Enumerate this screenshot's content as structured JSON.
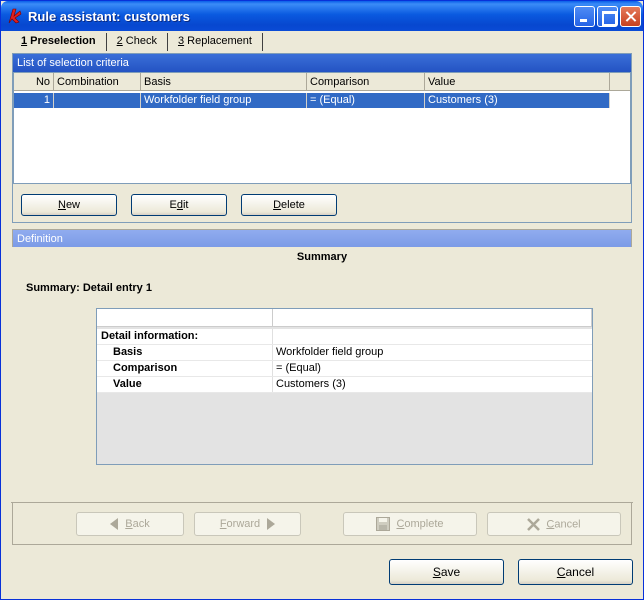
{
  "window": {
    "title": "Rule assistant: customers"
  },
  "tabs": [
    {
      "num": "1",
      "label": " Preselection"
    },
    {
      "num": "2",
      "label": " Check"
    },
    {
      "num": "3",
      "label": " Replacement"
    }
  ],
  "criteria": {
    "header": "List of selection criteria",
    "columns": [
      "No",
      "Combination",
      "Basis",
      "Comparison",
      "Value"
    ],
    "rows": [
      {
        "no": "1",
        "combination": "",
        "basis": "Workfolder field group",
        "comparison": "=  (Equal)",
        "value": "Customers (3)"
      }
    ]
  },
  "list_buttons": {
    "new": {
      "mnemonic": "N",
      "rest": "ew"
    },
    "edit": {
      "pre": "E",
      "mnemonic": "d",
      "rest": "it"
    },
    "delete": {
      "mnemonic": "D",
      "rest": "elete"
    }
  },
  "definition": {
    "header": "Definition",
    "summary_title": "Summary",
    "summary_sub": "Summary: Detail entry 1",
    "detail_title": "Detail information:",
    "details": [
      {
        "key": "Basis",
        "value": "Workfolder field group"
      },
      {
        "key": "Comparison",
        "value": "=  (Equal)"
      },
      {
        "key": "Value",
        "value": "Customers (3)"
      }
    ]
  },
  "nav_buttons": {
    "back": {
      "mnemonic": "B",
      "rest": "ack"
    },
    "forward": {
      "mnemonic": "F",
      "rest": "orward"
    },
    "complete": {
      "mnemonic": "C",
      "rest": "omplete"
    },
    "cancel": {
      "mnemonic": "C",
      "rest": "ancel"
    }
  },
  "footer_buttons": {
    "save": {
      "mnemonic": "S",
      "rest": "ave"
    },
    "cancel": {
      "mnemonic": "C",
      "rest": "ancel"
    }
  },
  "colors": {
    "selection": "#316ac5",
    "titlebar": "#0a5ae0"
  }
}
